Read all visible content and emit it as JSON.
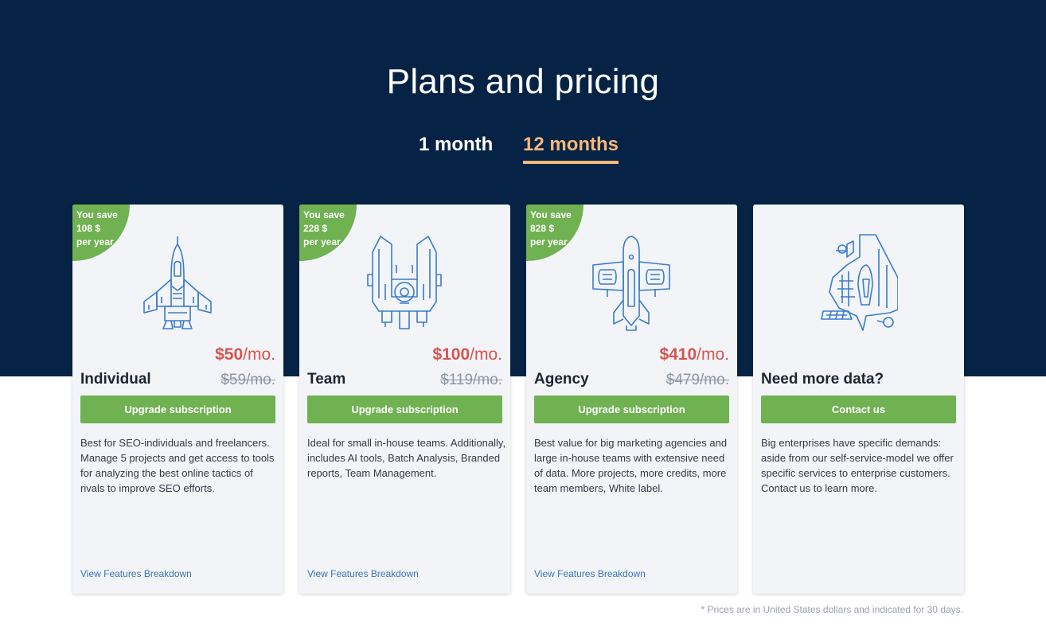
{
  "page": {
    "title": "Plans and pricing",
    "footnote": "* Prices are in United States dollars and indicated for 30 days."
  },
  "tabs": {
    "month": "1 month",
    "year": "12 months",
    "active": "12 months"
  },
  "colors": {
    "hero_background": "#062345",
    "accent_green": "#70b152",
    "active_tab": "#f6b77b",
    "price_red": "#d9534f",
    "link_blue": "#3a74b8"
  },
  "plans": [
    {
      "badge": [
        "You save",
        "108 $",
        "per year"
      ],
      "icon": "fighter-spaceship-icon",
      "price": "$50",
      "per": "/mo.",
      "name": "Individual",
      "old_price": "$59/mo.",
      "button": "Upgrade subscription",
      "description": "Best for SEO-individuals and freelancers. Manage 5 projects and get access to tools for analyzing the best online tactics of rivals to improve SEO efforts.",
      "link": "View Features Breakdown"
    },
    {
      "badge": [
        "You save",
        "228 $",
        "per year"
      ],
      "icon": "cruiser-spaceship-icon",
      "price": "$100",
      "per": "/mo.",
      "name": "Team",
      "old_price": "$119/mo.",
      "button": "Upgrade subscription",
      "description": "Ideal for small in-house teams. Additionally, includes AI tools, Batch Analysis, Branded reports, Team Management.",
      "link": "View Features Breakdown"
    },
    {
      "badge": [
        "You save",
        "828 $",
        "per year"
      ],
      "icon": "carrier-spaceship-icon",
      "price": "$410",
      "per": "/mo.",
      "name": "Agency",
      "old_price": "$479/mo.",
      "button": "Upgrade subscription",
      "description": "Best value for big marketing agencies and large in-house teams with extensive need of data. More projects, more credits, more team members, White label.",
      "link": "View Features Breakdown"
    },
    {
      "icon": "mothership-icon",
      "name": "Need more data?",
      "button": "Contact us",
      "description": "Big enterprises have specific demands: aside from our self-service-model we offer specific services to enterprise customers. Contact us to learn more."
    }
  ]
}
